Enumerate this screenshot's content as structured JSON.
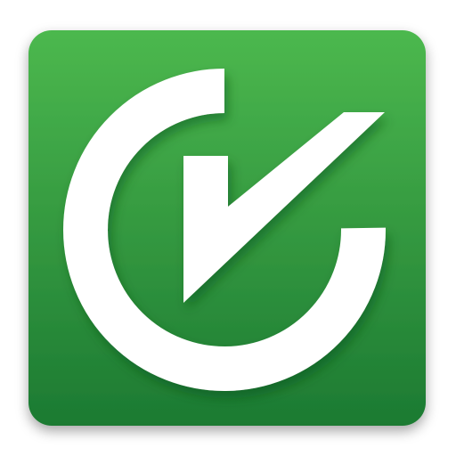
{
  "app_icon": {
    "name": "checkmark-logo",
    "colors": {
      "tile_top": "#4cb84e",
      "tile_bottom": "#1c7a32",
      "tile_shadow": "#0e4a1c",
      "glyph": "#ffffff"
    }
  }
}
